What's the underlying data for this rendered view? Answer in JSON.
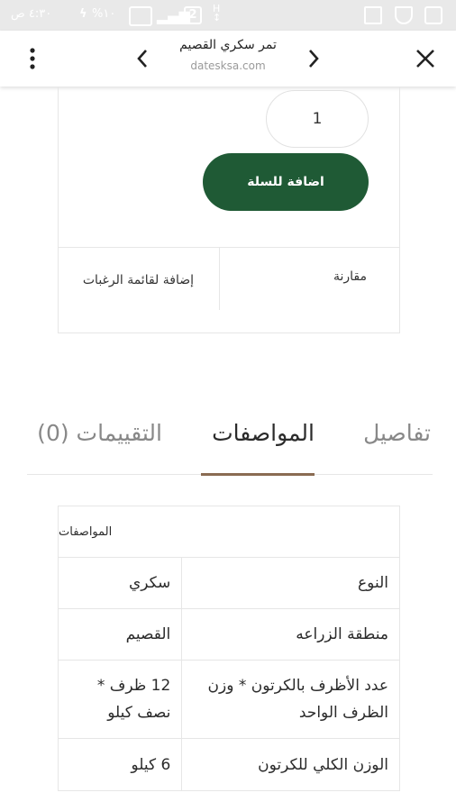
{
  "status_bar": {
    "time": "٤:٣٠ ص",
    "battery": "%١٠",
    "sim_slot": "2"
  },
  "browser": {
    "page_title": "تمر سكري القصيم",
    "domain": "datesksa.com",
    "icons": [
      "close-icon",
      "forward-icon",
      "back-icon",
      "more-vert-icon"
    ]
  },
  "product": {
    "quantity": "1",
    "add_to_cart_label": "اضافة للسلة",
    "compare_label": "مقارنة",
    "wishlist_label": "إضافة لقائمة الرغبات"
  },
  "tabs": {
    "items": [
      {
        "label": "تفاصيل"
      },
      {
        "label": "المواصفات"
      },
      {
        "label": "التقييمات (0)"
      }
    ],
    "active": "المواصفات"
  },
  "specs": {
    "heading": "المواصفات",
    "rows": [
      {
        "label": "النوع",
        "value": "سكري"
      },
      {
        "label": "منطقة الزراعه",
        "value": "القصيم"
      },
      {
        "label": "عدد الأظرف بالكرتون * وزن الظرف الواحد",
        "value": "12 ظرف * نصف كيلو"
      },
      {
        "label": "الوزن الكلي للكرتون",
        "value": "6 كيلو"
      }
    ]
  },
  "colors": {
    "accent_green": "#1f5a35",
    "tab_underline": "#8a6b52",
    "status_bar": "#e9e9e9"
  }
}
